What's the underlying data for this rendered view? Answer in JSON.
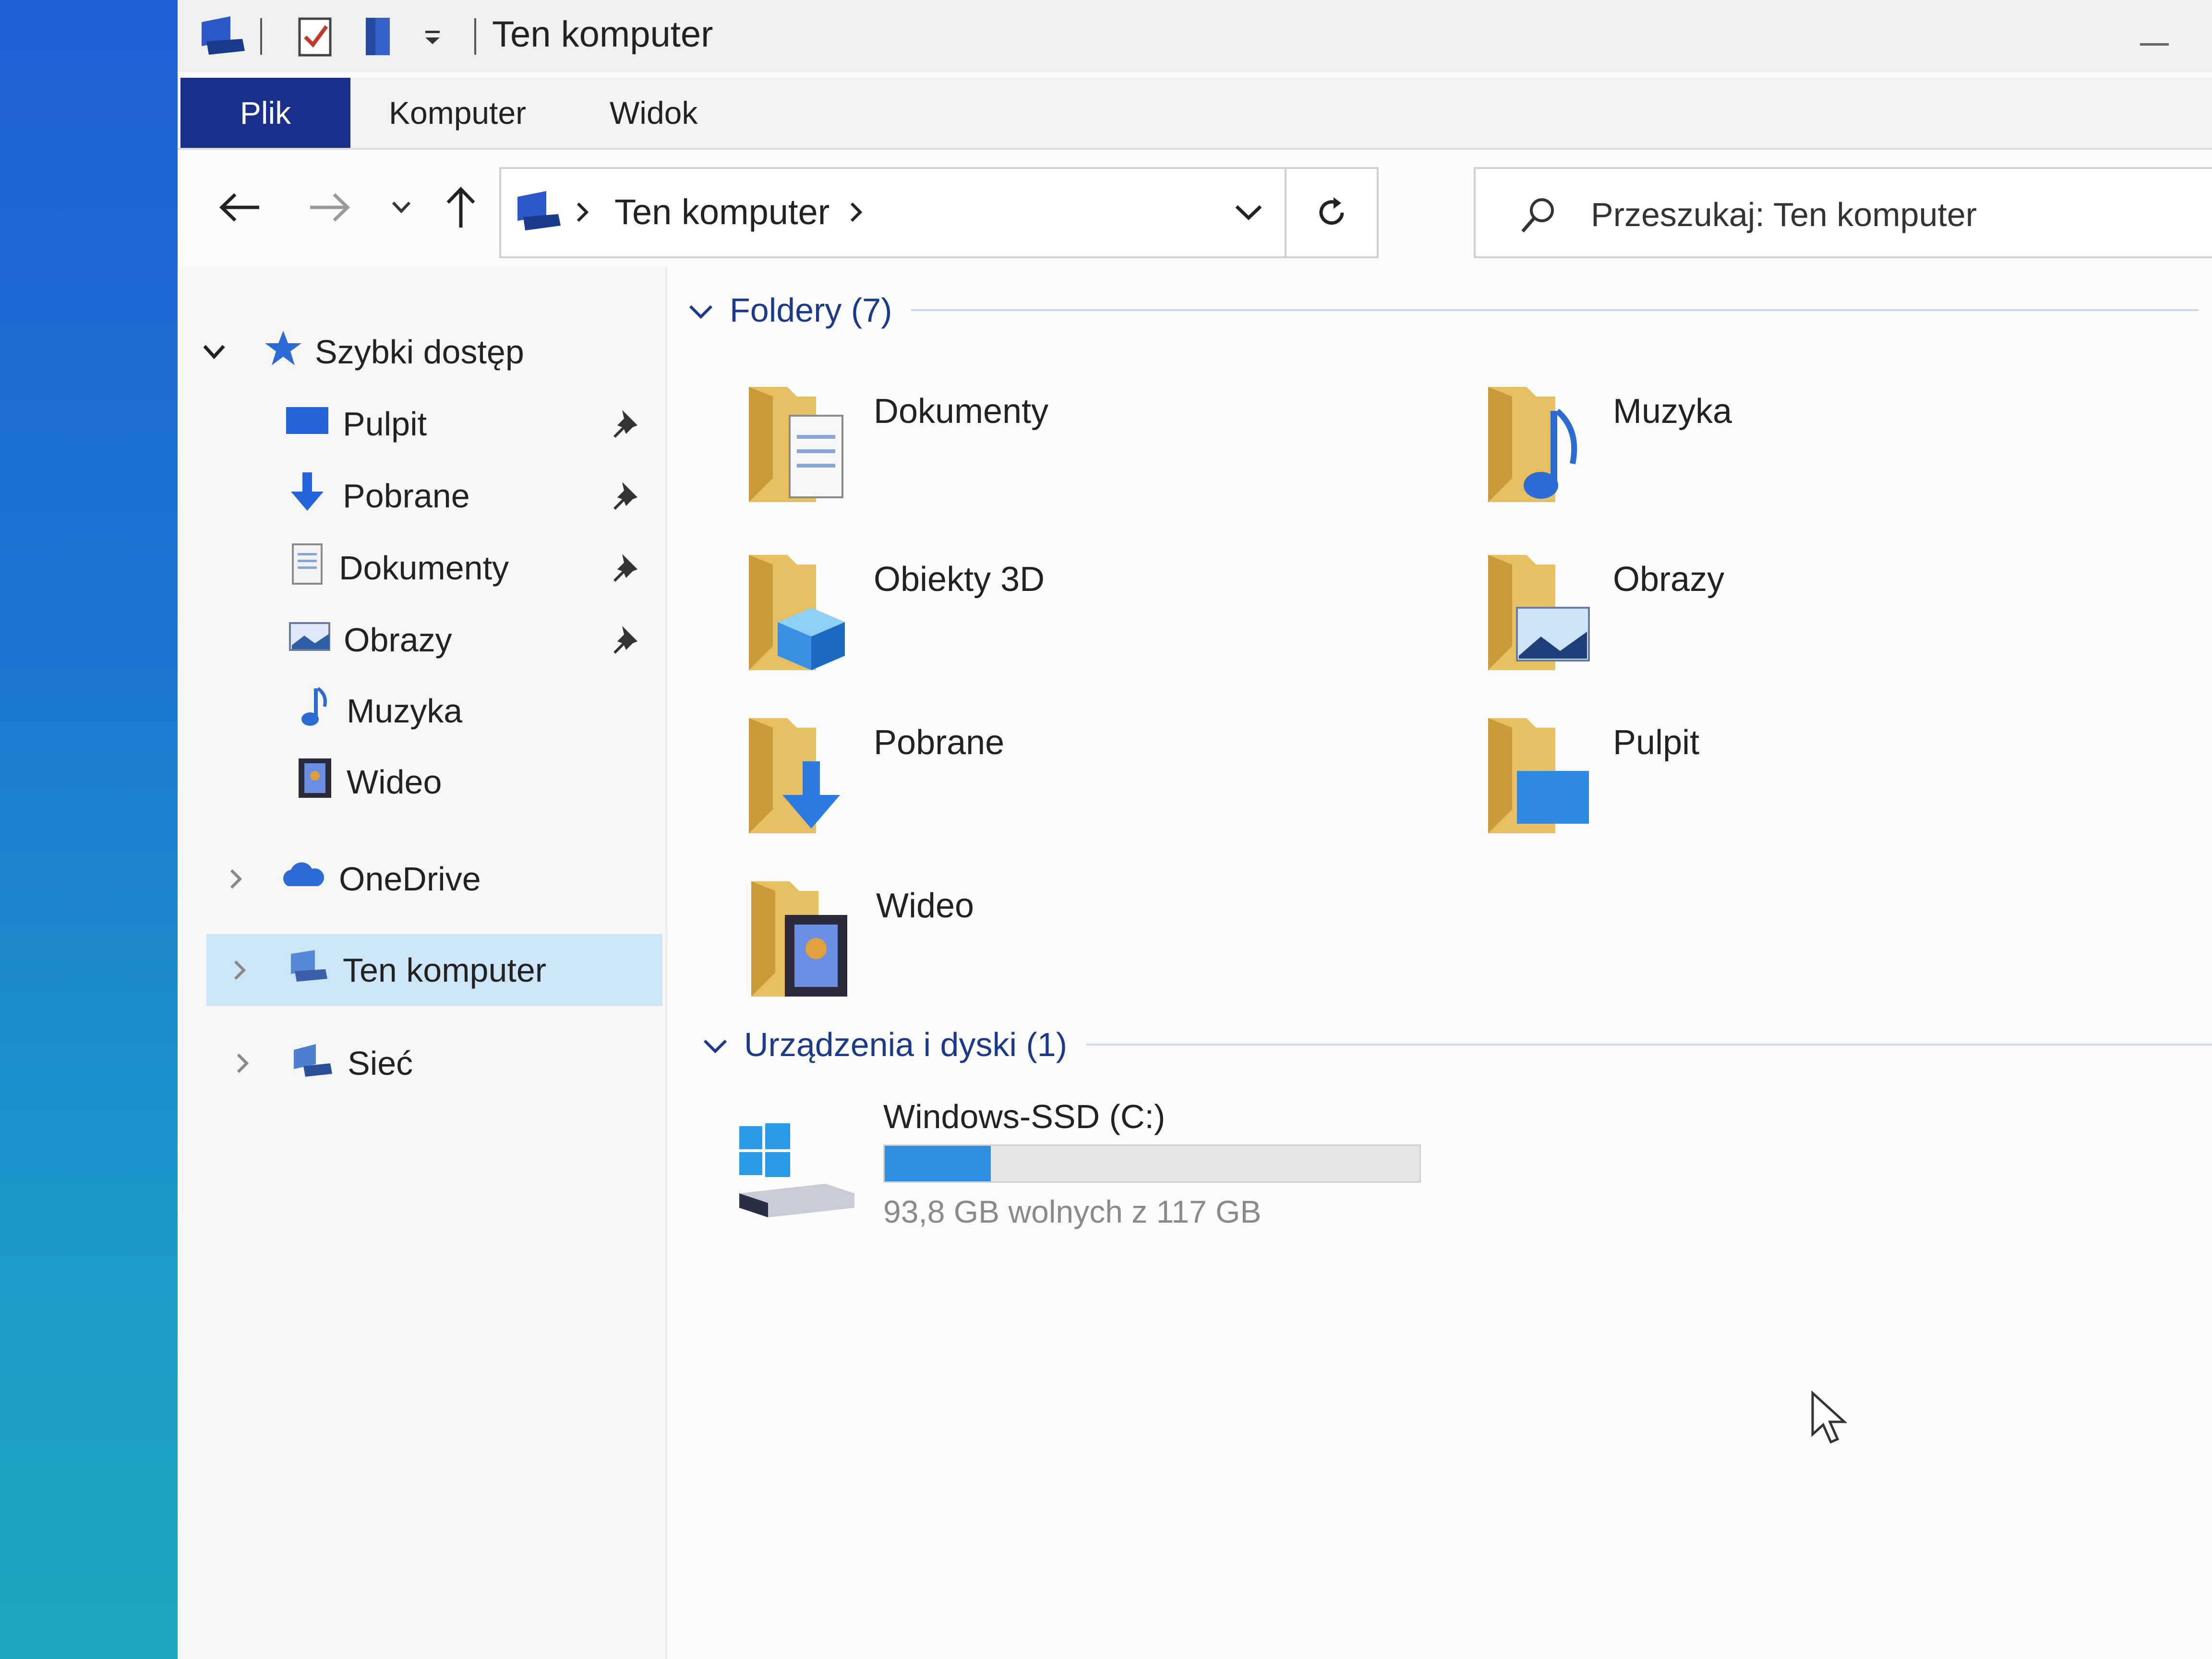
{
  "window": {
    "title": "Ten komputer"
  },
  "ribbon": {
    "tabs": [
      {
        "label": "Plik",
        "active": true
      },
      {
        "label": "Komputer"
      },
      {
        "label": "Widok"
      }
    ]
  },
  "address": {
    "path": "Ten komputer",
    "search_placeholder": "Przeszukaj: Ten komputer"
  },
  "nav": {
    "quick_access": "Szybki dostęp",
    "quick_items": [
      "Pulpit",
      "Pobrane",
      "Dokumenty",
      "Obrazy",
      "Muzyka",
      "Wideo"
    ],
    "onedrive": "OneDrive",
    "this_pc": "Ten komputer",
    "network": "Sieć"
  },
  "content": {
    "folders_header": "Foldery (7)",
    "folders": [
      "Dokumenty",
      "Muzyka",
      "Obiekty 3D",
      "Obrazy",
      "Pobrane",
      "Pulpit",
      "Wideo"
    ],
    "devices_header": "Urządzenia i dyski (1)",
    "drive": {
      "name": "Windows-SSD (C:)",
      "free_text": "93,8 GB wolnych z 117 GB",
      "used_fraction": 0.198
    }
  },
  "colors": {
    "accent": "#1a2f8c",
    "selection": "#cde6f7",
    "folder": "#e8c36a",
    "drive_fill": "#2e8fe0"
  }
}
